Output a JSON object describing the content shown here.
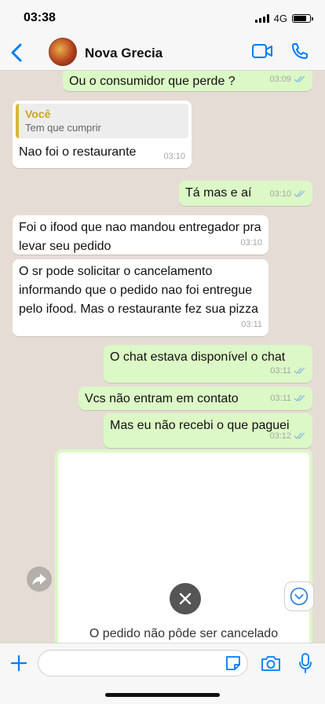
{
  "status": {
    "time": "03:38",
    "network": "4G"
  },
  "header": {
    "contact_name": "Nova Grecia"
  },
  "messages": [
    {
      "text": "Ou o consumidor que perde ?",
      "time": "03:09"
    },
    {
      "reply_author": "Você",
      "reply_text": "Tem que cumprir",
      "text": "Nao foi o restaurante",
      "time": "03:10"
    },
    {
      "text": "Tá mas e aí",
      "time": "03:10"
    },
    {
      "text": "Foi o ifood que nao mandou entregador pra levar seu pedido",
      "time": "03:10"
    },
    {
      "text": "O sr pode solicitar o cancelamento informando que o pedido nao foi entregue pelo ifood. Mas o restaurante fez sua pizza",
      "time": "03:11"
    },
    {
      "text": "O chat estava disponível o chat",
      "time": "03:11"
    },
    {
      "text": "Vcs não entram em contato",
      "time": "03:11"
    },
    {
      "text": "Mas eu não recebi o que paguei",
      "time": "03:12"
    }
  ],
  "image_card": {
    "caption": "O pedido não pôde ser cancelado"
  },
  "composer": {
    "placeholder": ""
  },
  "colors": {
    "accent": "#007aff",
    "outgoing_bubble": "#dcf8c6",
    "incoming_bubble": "#ffffff",
    "quote_author": "#c9a722",
    "read_ticks": "#8fbfe0"
  }
}
